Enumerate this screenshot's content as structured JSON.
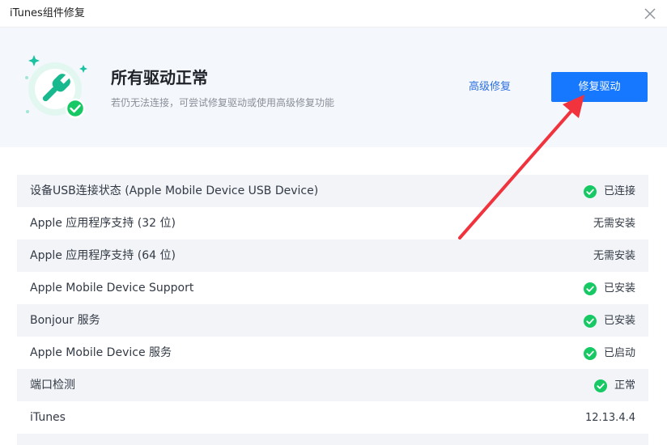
{
  "window": {
    "title": "iTunes组件修复"
  },
  "header": {
    "headline": "所有驱动正常",
    "subline": "若仍无法连接，可尝试修复驱动或使用高级修复功能",
    "advanced_link": "高级修复",
    "repair_button": "修复驱动",
    "icon": "wrench-check-icon"
  },
  "colors": {
    "accent": "#1677ff",
    "success": "#17c964",
    "header_bg": "#f4f7fb",
    "row_alt_bg": "#f2f4f8",
    "annotation_arrow": "#f0333c"
  },
  "rows": [
    {
      "label": "设备USB连接状态 (Apple Mobile Device USB Device)",
      "value": "已连接",
      "ok": true
    },
    {
      "label": "Apple 应用程序支持 (32 位)",
      "value": "无需安装",
      "ok": false
    },
    {
      "label": "Apple 应用程序支持 (64 位)",
      "value": "无需安装",
      "ok": false
    },
    {
      "label": "Apple Mobile Device Support",
      "value": "已安装",
      "ok": true
    },
    {
      "label": "Bonjour 服务",
      "value": "已安装",
      "ok": true
    },
    {
      "label": "Apple Mobile Device 服务",
      "value": "已启动",
      "ok": true
    },
    {
      "label": "端口检测",
      "value": "正常",
      "ok": true
    },
    {
      "label": "iTunes",
      "value": "12.13.4.4",
      "ok": false
    }
  ]
}
